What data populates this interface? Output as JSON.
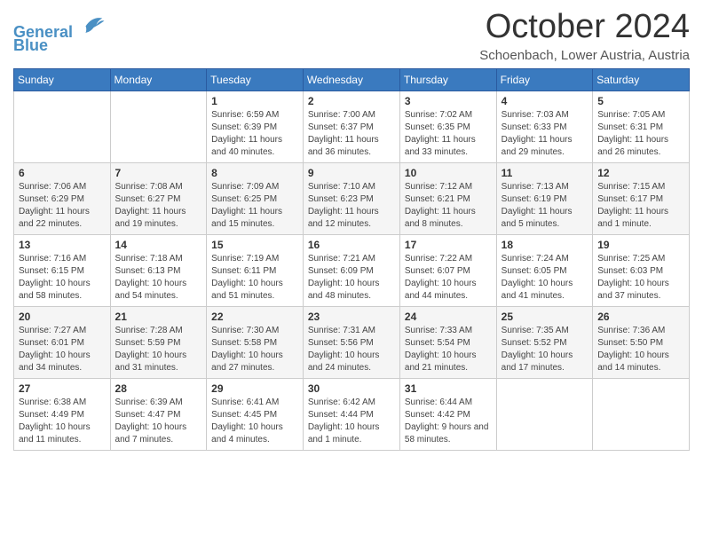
{
  "header": {
    "logo_line1": "General",
    "logo_line2": "Blue",
    "month": "October 2024",
    "location": "Schoenbach, Lower Austria, Austria"
  },
  "weekdays": [
    "Sunday",
    "Monday",
    "Tuesday",
    "Wednesday",
    "Thursday",
    "Friday",
    "Saturday"
  ],
  "weeks": [
    [
      {
        "day": "",
        "info": ""
      },
      {
        "day": "",
        "info": ""
      },
      {
        "day": "1",
        "info": "Sunrise: 6:59 AM\nSunset: 6:39 PM\nDaylight: 11 hours and 40 minutes."
      },
      {
        "day": "2",
        "info": "Sunrise: 7:00 AM\nSunset: 6:37 PM\nDaylight: 11 hours and 36 minutes."
      },
      {
        "day": "3",
        "info": "Sunrise: 7:02 AM\nSunset: 6:35 PM\nDaylight: 11 hours and 33 minutes."
      },
      {
        "day": "4",
        "info": "Sunrise: 7:03 AM\nSunset: 6:33 PM\nDaylight: 11 hours and 29 minutes."
      },
      {
        "day": "5",
        "info": "Sunrise: 7:05 AM\nSunset: 6:31 PM\nDaylight: 11 hours and 26 minutes."
      }
    ],
    [
      {
        "day": "6",
        "info": "Sunrise: 7:06 AM\nSunset: 6:29 PM\nDaylight: 11 hours and 22 minutes."
      },
      {
        "day": "7",
        "info": "Sunrise: 7:08 AM\nSunset: 6:27 PM\nDaylight: 11 hours and 19 minutes."
      },
      {
        "day": "8",
        "info": "Sunrise: 7:09 AM\nSunset: 6:25 PM\nDaylight: 11 hours and 15 minutes."
      },
      {
        "day": "9",
        "info": "Sunrise: 7:10 AM\nSunset: 6:23 PM\nDaylight: 11 hours and 12 minutes."
      },
      {
        "day": "10",
        "info": "Sunrise: 7:12 AM\nSunset: 6:21 PM\nDaylight: 11 hours and 8 minutes."
      },
      {
        "day": "11",
        "info": "Sunrise: 7:13 AM\nSunset: 6:19 PM\nDaylight: 11 hours and 5 minutes."
      },
      {
        "day": "12",
        "info": "Sunrise: 7:15 AM\nSunset: 6:17 PM\nDaylight: 11 hours and 1 minute."
      }
    ],
    [
      {
        "day": "13",
        "info": "Sunrise: 7:16 AM\nSunset: 6:15 PM\nDaylight: 10 hours and 58 minutes."
      },
      {
        "day": "14",
        "info": "Sunrise: 7:18 AM\nSunset: 6:13 PM\nDaylight: 10 hours and 54 minutes."
      },
      {
        "day": "15",
        "info": "Sunrise: 7:19 AM\nSunset: 6:11 PM\nDaylight: 10 hours and 51 minutes."
      },
      {
        "day": "16",
        "info": "Sunrise: 7:21 AM\nSunset: 6:09 PM\nDaylight: 10 hours and 48 minutes."
      },
      {
        "day": "17",
        "info": "Sunrise: 7:22 AM\nSunset: 6:07 PM\nDaylight: 10 hours and 44 minutes."
      },
      {
        "day": "18",
        "info": "Sunrise: 7:24 AM\nSunset: 6:05 PM\nDaylight: 10 hours and 41 minutes."
      },
      {
        "day": "19",
        "info": "Sunrise: 7:25 AM\nSunset: 6:03 PM\nDaylight: 10 hours and 37 minutes."
      }
    ],
    [
      {
        "day": "20",
        "info": "Sunrise: 7:27 AM\nSunset: 6:01 PM\nDaylight: 10 hours and 34 minutes."
      },
      {
        "day": "21",
        "info": "Sunrise: 7:28 AM\nSunset: 5:59 PM\nDaylight: 10 hours and 31 minutes."
      },
      {
        "day": "22",
        "info": "Sunrise: 7:30 AM\nSunset: 5:58 PM\nDaylight: 10 hours and 27 minutes."
      },
      {
        "day": "23",
        "info": "Sunrise: 7:31 AM\nSunset: 5:56 PM\nDaylight: 10 hours and 24 minutes."
      },
      {
        "day": "24",
        "info": "Sunrise: 7:33 AM\nSunset: 5:54 PM\nDaylight: 10 hours and 21 minutes."
      },
      {
        "day": "25",
        "info": "Sunrise: 7:35 AM\nSunset: 5:52 PM\nDaylight: 10 hours and 17 minutes."
      },
      {
        "day": "26",
        "info": "Sunrise: 7:36 AM\nSunset: 5:50 PM\nDaylight: 10 hours and 14 minutes."
      }
    ],
    [
      {
        "day": "27",
        "info": "Sunrise: 6:38 AM\nSunset: 4:49 PM\nDaylight: 10 hours and 11 minutes."
      },
      {
        "day": "28",
        "info": "Sunrise: 6:39 AM\nSunset: 4:47 PM\nDaylight: 10 hours and 7 minutes."
      },
      {
        "day": "29",
        "info": "Sunrise: 6:41 AM\nSunset: 4:45 PM\nDaylight: 10 hours and 4 minutes."
      },
      {
        "day": "30",
        "info": "Sunrise: 6:42 AM\nSunset: 4:44 PM\nDaylight: 10 hours and 1 minute."
      },
      {
        "day": "31",
        "info": "Sunrise: 6:44 AM\nSunset: 4:42 PM\nDaylight: 9 hours and 58 minutes."
      },
      {
        "day": "",
        "info": ""
      },
      {
        "day": "",
        "info": ""
      }
    ]
  ]
}
